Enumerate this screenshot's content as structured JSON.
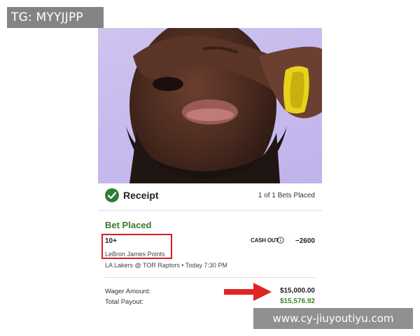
{
  "overlay": {
    "telegram_tag": "TG: MYYJJPP",
    "site_watermark": "www.cy-jiuyoutiyu.com"
  },
  "receipt": {
    "title": "Receipt",
    "bets_count": "1 of 1 Bets Placed",
    "status": "Bet Placed"
  },
  "bet": {
    "selection": "10+",
    "market": "LeBron James Points",
    "cash_out_label": "CASH OUT",
    "odds": "−2600",
    "game": "LA Lakers @ TOR Raptors • Today 7:30 PM"
  },
  "summary": {
    "wager_label": "Wager Amount:",
    "wager_value": "$15,000.00",
    "payout_label": "Total Payout:",
    "payout_value": "$15,576.92"
  },
  "icons": {
    "check": "check-circle-icon",
    "info": "info-icon",
    "arrow": "arrow-right-icon"
  },
  "colors": {
    "accent_green": "#3a7a2a",
    "highlight_red": "#d32020",
    "photo_bg": "#c7bbee"
  }
}
